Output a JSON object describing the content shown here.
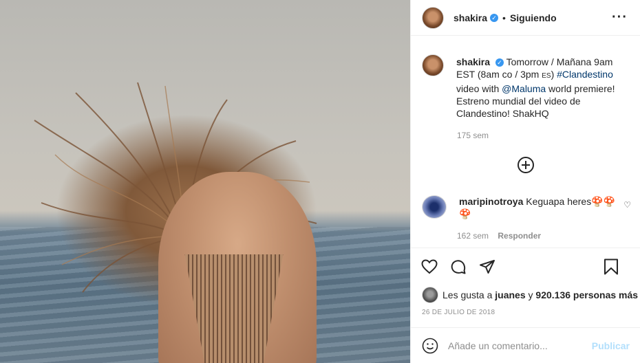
{
  "post": {
    "username": "shakira",
    "follow_label": "Siguiendo",
    "dot": "•",
    "more": "···"
  },
  "caption": {
    "username": "shakira",
    "text_part1": " Tomorrow / Mañana 9am EST (8am co / 3pm ",
    "text_es": "ES",
    "text_part2": ") ",
    "hashtag": "#Clandestino",
    "text_part3": " video with ",
    "mention": "@Maluma",
    "text_part4": " world premiere! Estreno mundial del video de Clandestino! ShakHQ",
    "time": "175 sem"
  },
  "comment": {
    "username": "maripinotroya",
    "text": "Keguapa heres🍄🍄🍄",
    "time": "162 sem",
    "reply": "Responder"
  },
  "likes": {
    "prefix": "Les gusta a",
    "user": "juanes",
    "and": "y",
    "count": "920.136 personas más"
  },
  "date": "26 DE JULIO DE 2018",
  "add_comment": {
    "placeholder": "Añade un comentario...",
    "publish": "Publicar"
  },
  "icons": {
    "verified": "✓",
    "heart_small": "♡"
  }
}
